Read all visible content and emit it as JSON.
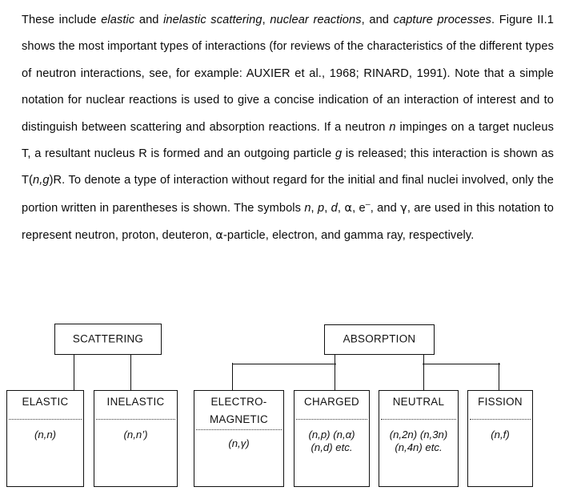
{
  "document": {
    "paragraph_segments": [
      {
        "t": "These include ",
        "s": "n"
      },
      {
        "t": "elastic",
        "s": "i"
      },
      {
        "t": " and ",
        "s": "n"
      },
      {
        "t": "inelastic scattering",
        "s": "i"
      },
      {
        "t": ", ",
        "s": "n"
      },
      {
        "t": "nuclear reactions",
        "s": "i"
      },
      {
        "t": ", and ",
        "s": "n"
      },
      {
        "t": "capture processes",
        "s": "i"
      },
      {
        "t": ". Figure II.1 shows the most important types of interactions (for reviews of the characteristics of the different types of neutron interactions, see, for example: AUXIER et al., 1968; RINARD, 1991). Note that a simple notation for nuclear reactions is used to give a concise indication of an interaction of interest and to distinguish between scattering and absorption reactions. If a neutron ",
        "s": "n"
      },
      {
        "t": "n",
        "s": "i"
      },
      {
        "t": " impinges on a target nucleus T, a resultant nucleus R is formed and an outgoing particle ",
        "s": "n"
      },
      {
        "t": "g",
        "s": "i"
      },
      {
        "t": " is released; this interaction is shown as T(",
        "s": "n"
      },
      {
        "t": "n,g",
        "s": "i"
      },
      {
        "t": ")R. To denote a type of interaction without regard for the initial and final nuclei involved, only the portion written in parentheses is shown. The symbols ",
        "s": "n"
      },
      {
        "t": "n",
        "s": "i"
      },
      {
        "t": ", ",
        "s": "n"
      },
      {
        "t": "p",
        "s": "i"
      },
      {
        "t": ", ",
        "s": "n"
      },
      {
        "t": "d",
        "s": "i"
      },
      {
        "t": ", α, e⁻, and γ, are used in this notation to represent neutron, proton, deuteron, α-particle, electron, and gamma ray, respectively.",
        "s": "n"
      }
    ],
    "full_text": "These include elastic and inelastic scattering, nuclear reactions, and capture processes. Figure II.1 shows the most important types of interactions (for reviews of the characteristics of the different types of neutron interactions, see, for example: AUXIER et al., 1968; RINARD, 1991). Note that a simple notation for nuclear reactions is used to give a concise indication of an interaction of interest and to distinguish between scattering and absorption reactions. If a neutron n impinges on a target nucleus T, a resultant nucleus R is formed and an outgoing particle g is released; this interaction is shown as T(n,g)R. To denote a type of interaction without regard for the initial and final nuclei involved, only the portion written in parentheses is shown. The symbols n, p, d, α, e⁻, and γ, are used in this notation to represent neutron, proton, deuteron, α-particle, electron, and gamma ray, respectively."
  },
  "figure": {
    "caption_reference": "Figure II.1",
    "line_color": "#111111",
    "background_color": "#ffffff",
    "parents": [
      {
        "id": "scattering",
        "label": "SCATTERING"
      },
      {
        "id": "absorption",
        "label": "ABSORPTION"
      }
    ],
    "leaves": [
      {
        "id": "elastic",
        "parent": "scattering",
        "label": "ELASTIC",
        "label_line2": "",
        "notation_line1": "(n,n)",
        "notation_line2": ""
      },
      {
        "id": "inelastic",
        "parent": "scattering",
        "label": "INELASTIC",
        "label_line2": "",
        "notation_line1": "(n,n’)",
        "notation_line2": ""
      },
      {
        "id": "electromagnetic",
        "parent": "absorption",
        "label": "ELECTRO-",
        "label_line2": "MAGNETIC",
        "notation_line1": "(n,γ)",
        "notation_line2": ""
      },
      {
        "id": "charged",
        "parent": "absorption",
        "label": "CHARGED",
        "label_line2": "",
        "notation_line1": "(n,p) (n,α)",
        "notation_line2": "(n,d) etc."
      },
      {
        "id": "neutral",
        "parent": "absorption",
        "label": "NEUTRAL",
        "label_line2": "",
        "notation_line1": "(n,2n) (n,3n)",
        "notation_line2": "(n,4n) etc."
      },
      {
        "id": "fission",
        "parent": "absorption",
        "label": "FISSION",
        "label_line2": "",
        "notation_line1": "(n,f)",
        "notation_line2": ""
      }
    ]
  }
}
